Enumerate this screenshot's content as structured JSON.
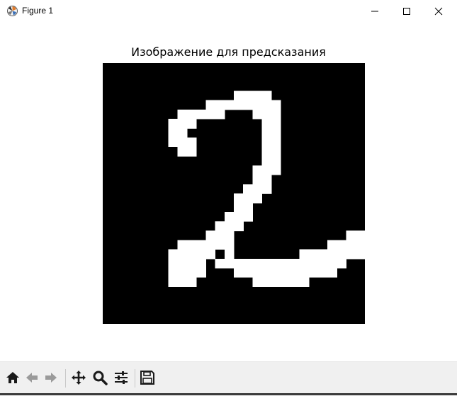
{
  "window": {
    "title": "Figure 1",
    "controls": [
      "minimize",
      "maximize",
      "close"
    ]
  },
  "figure": {
    "title": "Изображение для предсказания",
    "image": {
      "description_type": "binary digit bitmap",
      "background_color": "#000000",
      "foreground_color": "#ffffff",
      "grid": [
        "0000000000000000000000000000",
        "0000000000000000000000000000",
        "0000000000000000000000000000",
        "0000000000000011110000000000",
        "0000000000011111111000000000",
        "0000000011111000111000000000",
        "0000000111000000011000000000",
        "0000000110000000011000000000",
        "0000000111000000011000000000",
        "0000000011000000011000000000",
        "0000000000000000011000000000",
        "0000000000000000111000000000",
        "0000000000000000110000000000",
        "0000000000000001110000000000",
        "0000000000000011100000000000",
        "0000000000000011000000000000",
        "0000000000000111000000000000",
        "0000000000001110000000000000",
        "0000000000011100000000000011",
        "0000000011111100000000001111",
        "0000000111110100000001111111",
        "0000000111101111111111111100",
        "0000000111100011111111111000",
        "0000000111000000111111000000",
        "0000000000000000000000000000",
        "0000000000000000000000000000",
        "0000000000000000000000000000",
        "0000000000000000000000000000"
      ]
    }
  },
  "toolbar": {
    "buttons": [
      {
        "name": "home-icon",
        "tooltip": "Home"
      },
      {
        "name": "back-icon",
        "tooltip": "Back"
      },
      {
        "name": "forward-icon",
        "tooltip": "Forward"
      },
      {
        "name": "pan-icon",
        "tooltip": "Pan"
      },
      {
        "name": "zoom-icon",
        "tooltip": "Zoom"
      },
      {
        "name": "configure-subplots-icon",
        "tooltip": "Subplots"
      },
      {
        "name": "save-icon",
        "tooltip": "Save"
      }
    ]
  }
}
